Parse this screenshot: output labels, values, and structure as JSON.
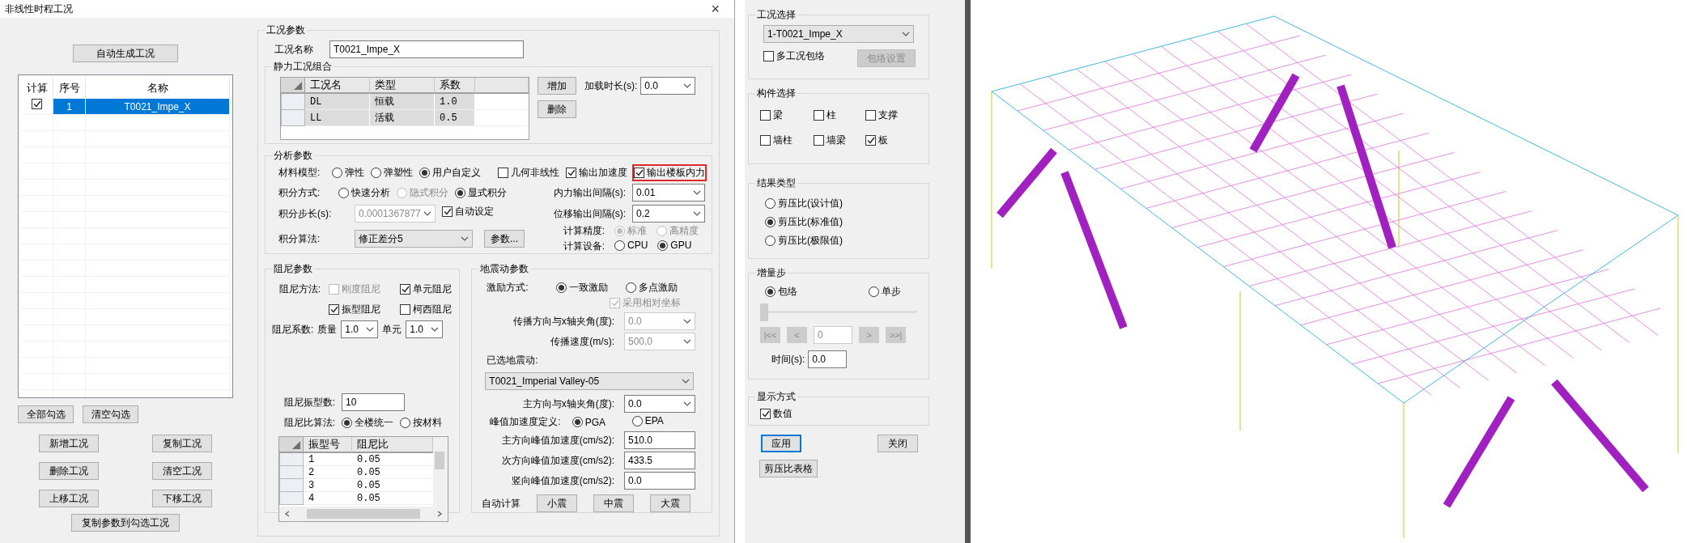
{
  "dialog": {
    "title": "非线性时程工况",
    "close": "×"
  },
  "case_list": {
    "auto_button": "自动生成工况",
    "columns": [
      "计算",
      "序号",
      "名称"
    ],
    "rows": [
      {
        "checked": true,
        "selected": true,
        "index": "1",
        "name": "T0021_Impe_X"
      }
    ],
    "check_buttons": [
      "全部勾选",
      "清空勾选"
    ],
    "action_buttons": [
      "新增工况",
      "复制工况",
      "删除工况",
      "清空工况",
      "上移工况",
      "下移工况"
    ],
    "copy_button": "复制参数到勾选工况"
  },
  "case_params": {
    "title": "工况参数",
    "name_label": "工况名称",
    "name_value": "T0021_Impe_X"
  },
  "static_combo": {
    "title": "静力工况组合",
    "columns": [
      "工况名",
      "类型",
      "系数"
    ],
    "rows": [
      {
        "name": "DL",
        "type": "恒载",
        "factor": "1.0"
      },
      {
        "name": "LL",
        "type": "活载",
        "factor": "0.5"
      }
    ],
    "buttons": [
      "增加",
      "删除"
    ],
    "load_time_label": "加载时长(s):",
    "load_time_value": "0.0"
  },
  "analysis": {
    "title": "分析参数",
    "material_label": "材料模型:",
    "material_options": [
      {
        "label": "弹性",
        "selected": false
      },
      {
        "label": "弹塑性",
        "selected": false
      },
      {
        "label": "用户自定义",
        "selected": true
      }
    ],
    "output_options": [
      {
        "label": "几何非线性",
        "checked": false,
        "highlighted": false
      },
      {
        "label": "输出加速度",
        "checked": true,
        "highlighted": false
      },
      {
        "label": "输出楼板内力",
        "checked": true,
        "highlighted": true
      }
    ],
    "integration_label": "积分方式:",
    "integration_options": [
      {
        "label": "快速分析",
        "selected": false,
        "disabled": false
      },
      {
        "label": "隐式积分",
        "selected": false,
        "disabled": true
      },
      {
        "label": "显式积分",
        "selected": true,
        "disabled": false
      }
    ],
    "force_interval_label": "内力输出间隔(s):",
    "force_interval_value": "0.01",
    "step_label": "积分步长(s):",
    "step_value": "0.0001367877",
    "step_disabled": true,
    "auto_label": "自动设定",
    "auto_checked": true,
    "disp_interval_label": "位移输出间隔(s):",
    "disp_interval_value": "0.2",
    "algorithm_label": "积分算法:",
    "algorithm_value": "修正差分5",
    "params_button": "参数...",
    "precision_label": "计算精度:",
    "precision_options": [
      {
        "label": "标准",
        "selected": true,
        "disabled": true
      },
      {
        "label": "高精度",
        "selected": false,
        "disabled": true
      }
    ],
    "device_label": "计算设备:",
    "device_options": [
      {
        "label": "CPU",
        "selected": false
      },
      {
        "label": "GPU",
        "selected": true
      }
    ]
  },
  "damping": {
    "title": "阻尼参数",
    "method_label": "阻尼方法:",
    "methods": [
      {
        "label": "刚度阻尼",
        "checked": false,
        "disabled": true
      },
      {
        "label": "单元阻尼",
        "checked": true,
        "disabled": false
      },
      {
        "label": "振型阻尼",
        "checked": true,
        "disabled": false
      },
      {
        "label": "柯西阻尼",
        "checked": false,
        "disabled": false
      }
    ],
    "coef_label": "阻尼系数:",
    "mass_label": "质量",
    "mass_value": "1.0",
    "element_label": "单元",
    "element_value": "1.0",
    "modes_label": "阻尼振型数:",
    "modes_value": "10",
    "ratio_label": "阻尼比算法:",
    "ratio_options": [
      {
        "label": "全楼统一",
        "selected": true
      },
      {
        "label": "按材料",
        "selected": false
      }
    ],
    "columns": [
      "振型号",
      "阻尼比"
    ],
    "rows": [
      {
        "mode": "1",
        "ratio": "0.05"
      },
      {
        "mode": "2",
        "ratio": "0.05"
      },
      {
        "mode": "3",
        "ratio": "0.05"
      },
      {
        "mode": "4",
        "ratio": "0.05"
      }
    ]
  },
  "seismic": {
    "title": "地震动参数",
    "excitation_label": "激励方式:",
    "excitation_options": [
      {
        "label": "一致激励",
        "selected": true
      },
      {
        "label": "多点激励",
        "selected": false
      }
    ],
    "relative_label": "采用相对坐标",
    "relative_checked": true,
    "relative_disabled": true,
    "prop_fields": [
      {
        "label": "传播方向与x轴夹角(度):",
        "value": "0.0",
        "disabled": true
      },
      {
        "label": "传播速度(m/s):",
        "value": "500.0",
        "disabled": true
      }
    ],
    "record_label": "已选地震动:",
    "record_value": "T0021_Imperial Valley-05",
    "angle_label": "主方向与x轴夹角(度):",
    "angle_value": "0.0",
    "peak_label": "峰值加速度定义:",
    "peak_options": [
      {
        "label": "PGA",
        "selected": true
      },
      {
        "label": "EPA",
        "selected": false
      }
    ],
    "accel_fields": [
      {
        "label": "主方向峰值加速度(cm/s2):",
        "value": "510.0"
      },
      {
        "label": "次方向峰值加速度(cm/s2):",
        "value": "433.5"
      },
      {
        "label": "竖向峰值加速度(cm/s2):",
        "value": "0.0"
      }
    ],
    "auto_label": "自动计算",
    "auto_buttons": [
      "小震",
      "中震",
      "大震"
    ]
  },
  "result_panel": {
    "case_title": "工况选择",
    "case_value": "1-T0021_Impe_X",
    "envelope_label": "多工况包络",
    "envelope_checked": false,
    "envelope_button": "包络设置",
    "envelope_button_disabled": true,
    "member_title": "构件选择",
    "members": [
      {
        "label": "梁",
        "checked": false
      },
      {
        "label": "柱",
        "checked": false
      },
      {
        "label": "支撑",
        "checked": false
      },
      {
        "label": "墙柱",
        "checked": false
      },
      {
        "label": "墙梁",
        "checked": false
      },
      {
        "label": "板",
        "checked": true
      }
    ],
    "result_title": "结果类型",
    "results": [
      {
        "label": "剪压比(设计值)",
        "selected": false
      },
      {
        "label": "剪压比(标准值)",
        "selected": true
      },
      {
        "label": "剪压比(极限值)",
        "selected": false
      }
    ],
    "step_title": "增量步",
    "step_modes": [
      {
        "label": "包络",
        "selected": true
      },
      {
        "label": "单步",
        "selected": false
      }
    ],
    "slider": {
      "level": 0
    },
    "nav_buttons": [
      "|<<",
      "<",
      ">",
      ">>|"
    ],
    "nav_disabled": true,
    "step_value": "0",
    "time_label": "时间(s):",
    "time_value": "0.0",
    "display_title": "显示方式",
    "display_label": "数值",
    "display_checked": true,
    "buttons": [
      {
        "label": "应用",
        "focused": true
      },
      {
        "label": "关闭",
        "focused": false
      }
    ],
    "table_button": "剪压比表格"
  }
}
